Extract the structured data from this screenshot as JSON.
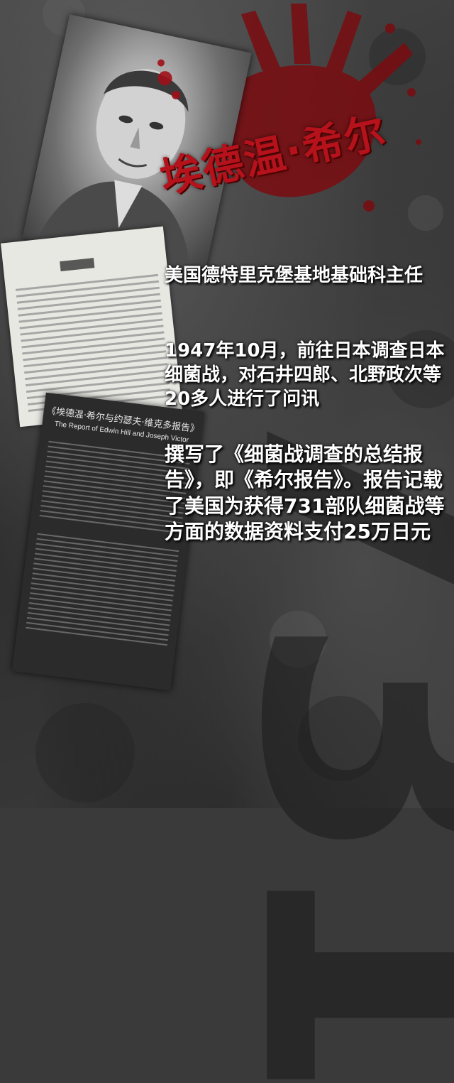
{
  "headline": "埃德温·希尔",
  "role": "美国德特里克堡基地基础科主任",
  "visit": "1947年10月，前往日本调查日本细菌战，对石井四郎、北野政次等20多人进行了问讯",
  "report": "撰写了《细菌战调查的总结报告》，即《希尔报告》。报告记载了美国为获得731部队细菌战等方面的数据资料支付25万日元",
  "document": {
    "title_cn": "《埃德温·希尔与约瑟夫·维克多报告》",
    "title_en": "The Report of Edwin Hill and Joseph Victor"
  },
  "background_number": "731",
  "colors": {
    "headline": "#b5121b",
    "body_text": "#ffffff",
    "background": "#3a3a3a"
  }
}
